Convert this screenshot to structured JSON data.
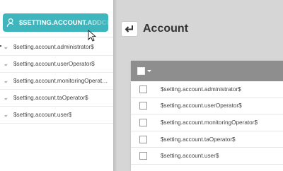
{
  "sidebar": {
    "add_button_label": "$SETTING.ACCOUNT.ADDCUSTOMOPERATOR$",
    "items": [
      {
        "label": "$setting.account.administrator$"
      },
      {
        "label": "$setting.account.userOperator$"
      },
      {
        "label": "$setting.account.monitoringOperator$"
      },
      {
        "label": "$setting.account.taOperator$"
      },
      {
        "label": "$setting.account.user$"
      }
    ]
  },
  "header": {
    "title": "Account",
    "back_icon": "back-arrow-icon"
  },
  "table": {
    "rows": [
      {
        "label": "$setting.account.administrator$"
      },
      {
        "label": "$setting.account.userOperator$"
      },
      {
        "label": "$setting.account.monitoringOperator$"
      },
      {
        "label": "$setting.account.taOperator$"
      },
      {
        "label": "$setting.account.user$"
      }
    ]
  },
  "colors": {
    "accent": "#3fb6bd",
    "table_header": "#8e8e8e",
    "background": "#d6d6d6"
  }
}
